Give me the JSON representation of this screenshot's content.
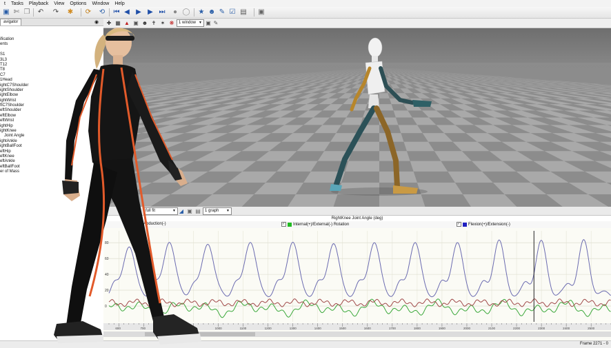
{
  "menu": [
    "t",
    "Tasks",
    "Playback",
    "View",
    "Options",
    "Window",
    "Help"
  ],
  "navigator": {
    "tab_label": "avigator",
    "items": [
      "ification",
      "ents",
      "",
      "S1",
      "3L3",
      "T12",
      "T8",
      "C7",
      "1Head",
      "ightC7Shoulder",
      "ightShoulder",
      "ightElbow",
      "ightWrist",
      "ftC7Shoulder",
      "eftShoulder",
      "eftElbow",
      "eftWrist",
      "ightHip",
      "ightKnee",
      "Joint Angle",
      "ightAnkle",
      "ightBallFoot",
      "eftHip",
      "eftKnee",
      "eftAnkle",
      "eftBallFoot",
      "er of Mass"
    ]
  },
  "viewport": {
    "window_select": "1 window"
  },
  "graph": {
    "zoom_select": "full fit",
    "layout_select": "1 graph",
    "title": "RightKnee Joint Angle (deg)",
    "legend": [
      {
        "label": "Abduction(-)",
        "color": "#c05050",
        "checked": true
      },
      {
        "label": "Internal(+)/External(-) Rotation",
        "color": "#22bb22",
        "checked": true
      },
      {
        "label": "Flexion(+)/Extension(-)",
        "color": "#2020c0",
        "checked": true
      }
    ],
    "y_ticks": [
      "80",
      "60",
      "40",
      "20",
      "0"
    ],
    "x_ticks": [
      "600",
      "700",
      "800",
      "900",
      "1000",
      "1100",
      "1200",
      "1300",
      "1400",
      "1500",
      "1600",
      "1700",
      "1800",
      "1900",
      "2000",
      "2100",
      "2200",
      "2300",
      "2400",
      "2500"
    ]
  },
  "chart_data": {
    "type": "line",
    "title": "RightKnee Joint Angle (deg)",
    "xlabel": "",
    "ylabel": "",
    "xlim": [
      560,
      2580
    ],
    "ylim": [
      -20,
      95
    ],
    "series": [
      {
        "name": "Flexion(+)/Extension(-)",
        "color": "#6a6ab0",
        "peaks": [
          640,
          802,
          958,
          1128,
          1298,
          1462,
          1626,
          1790,
          1960,
          2128,
          2298,
          2470
        ],
        "peak_values": [
          78,
          84,
          82,
          84,
          83,
          81,
          82,
          82,
          80,
          82,
          80,
          80
        ],
        "baseline": 15
      },
      {
        "name": "Abduction(-)",
        "color": "#a04848",
        "level": 4
      },
      {
        "name": "Internal(+)/External(-) Rotation",
        "color": "#3aa83a",
        "level": -3
      }
    ]
  },
  "status": {
    "frame": "Frame 2271 - 0"
  }
}
